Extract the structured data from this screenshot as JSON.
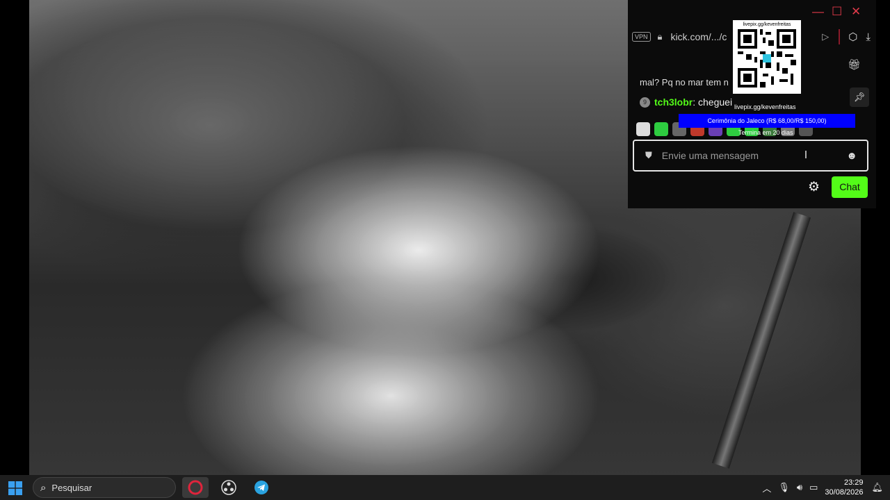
{
  "window": {
    "controls": [
      "minimize",
      "maximize",
      "close"
    ]
  },
  "browser": {
    "vpn_label": "VPN",
    "url": "kick.com/.../c"
  },
  "chat": {
    "partial_line": "mal? Pq no mar tem n",
    "message": {
      "badge": "9",
      "username": "tch3lobr",
      "text": ": cheguei"
    },
    "input_placeholder": "Envie uma mensagem",
    "send_label": "Chat"
  },
  "overlay": {
    "qr_caption": "livepix.gg/kevenfreitas",
    "url_caption": "livepix.gg/kevenfreitas",
    "goal_text": "Cerimônia do Jaleco (R$ 68,00/R$ 150,00)",
    "goal_sub": "Termina em 20 dias"
  },
  "taskbar": {
    "search_placeholder": "Pesquisar",
    "time": "23:29",
    "date": "30/08/2026",
    "apps": [
      "opera-icon",
      "obs-icon",
      "telegram-icon"
    ]
  },
  "colors": {
    "kick_green": "#53fc18",
    "goal_blue": "#0000ff",
    "window_red": "#e03a4a"
  }
}
